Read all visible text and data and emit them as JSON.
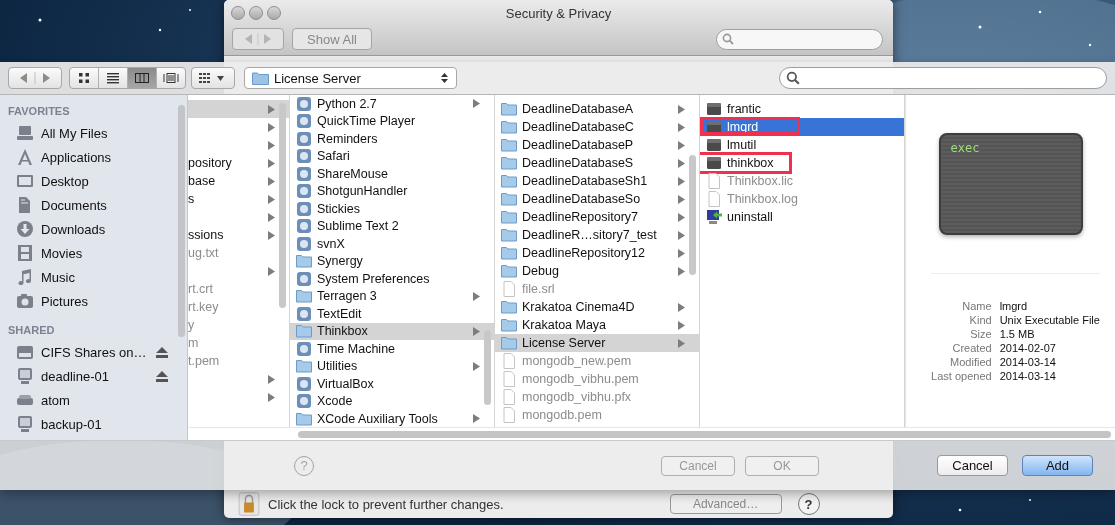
{
  "settings_window": {
    "title": "Security & Privacy",
    "show_all_button": "Show All",
    "help_label": "?",
    "cancel_button": {
      "label": "Cancel",
      "disabled": true
    },
    "ok_button": {
      "label": "OK",
      "disabled": true
    },
    "lock_message": "Click the lock to prevent further changes.",
    "advanced_button": "Advanced…",
    "help_button": "?"
  },
  "toolbar": {
    "views": [
      {
        "kind": "icons",
        "selected": false
      },
      {
        "kind": "list",
        "selected": false
      },
      {
        "kind": "columns",
        "selected": true
      },
      {
        "kind": "coverflow",
        "selected": false
      }
    ],
    "path": "License Server"
  },
  "sidebar": {
    "sections": [
      {
        "title": "FAVORITES",
        "items": [
          {
            "label": "All My Files",
            "kind": "files",
            "eject": false
          },
          {
            "label": "Applications",
            "kind": "apps",
            "eject": false
          },
          {
            "label": "Desktop",
            "kind": "desktop",
            "eject": false
          },
          {
            "label": "Documents",
            "kind": "documents",
            "eject": false
          },
          {
            "label": "Downloads",
            "kind": "downloads",
            "eject": false
          },
          {
            "label": "Movies",
            "kind": "movies",
            "eject": false
          },
          {
            "label": "Music",
            "kind": "music",
            "eject": false
          },
          {
            "label": "Pictures",
            "kind": "pictures",
            "eject": false
          }
        ]
      },
      {
        "title": "SHARED",
        "items": [
          {
            "label": "CIFS Shares on…",
            "kind": "server",
            "eject": true
          },
          {
            "label": "deadline-01",
            "kind": "computer",
            "eject": true
          },
          {
            "label": "atom",
            "kind": "drive",
            "eject": false
          },
          {
            "label": "backup-01",
            "kind": "computer",
            "eject": false
          }
        ]
      }
    ]
  },
  "columns": [
    {
      "focused": false,
      "rows": [
        {
          "selected": true,
          "arrow": true,
          "dim": false
        },
        {
          "selected": false,
          "arrow": true,
          "dim": false
        },
        {
          "selected": false,
          "arrow": true,
          "dim": false
        },
        {
          "label": "pository",
          "selected": false,
          "arrow": true,
          "dim": false
        },
        {
          "label": "base",
          "selected": false,
          "arrow": true,
          "dim": false
        },
        {
          "label": "s",
          "selected": false,
          "arrow": true,
          "dim": false
        },
        {
          "selected": false,
          "arrow": true,
          "dim": false
        },
        {
          "label": "ssions",
          "selected": false,
          "arrow": true,
          "dim": false
        },
        {
          "label": "ug.txt",
          "selected": false,
          "arrow": false,
          "dim": true
        },
        {
          "selected": false,
          "arrow": true,
          "dim": false
        },
        {
          "label": "rt.crt",
          "selected": false,
          "arrow": false,
          "dim": true
        },
        {
          "label": "rt.key",
          "selected": false,
          "arrow": false,
          "dim": true
        },
        {
          "label": "y",
          "selected": false,
          "arrow": false,
          "dim": true
        },
        {
          "label": "m",
          "selected": false,
          "arrow": false,
          "dim": true
        },
        {
          "label": "t.pem",
          "selected": false,
          "arrow": false,
          "dim": true
        },
        {
          "selected": false,
          "arrow": true,
          "dim": false
        },
        {
          "selected": false,
          "arrow": true,
          "dim": false
        }
      ]
    },
    {
      "focused": false,
      "rows": [
        {
          "label": "Python 2.7",
          "kind": "app",
          "selected": false,
          "arrow": true,
          "dim": false
        },
        {
          "label": "QuickTime Player",
          "kind": "app",
          "selected": false,
          "arrow": false,
          "dim": false
        },
        {
          "label": "Reminders",
          "kind": "app",
          "selected": false,
          "arrow": false,
          "dim": false
        },
        {
          "label": "Safari",
          "kind": "app",
          "selected": false,
          "arrow": false,
          "dim": false
        },
        {
          "label": "ShareMouse",
          "kind": "app",
          "selected": false,
          "arrow": false,
          "dim": false
        },
        {
          "label": "ShotgunHandler",
          "kind": "app",
          "selected": false,
          "arrow": false,
          "dim": false
        },
        {
          "label": "Stickies",
          "kind": "app",
          "selected": false,
          "arrow": false,
          "dim": false
        },
        {
          "label": "Sublime Text 2",
          "kind": "app",
          "selected": false,
          "arrow": false,
          "dim": false
        },
        {
          "label": "svnX",
          "kind": "app",
          "selected": false,
          "arrow": false,
          "dim": false
        },
        {
          "label": "Synergy",
          "kind": "folder",
          "selected": false,
          "arrow": false,
          "dim": false
        },
        {
          "label": "System Preferences",
          "kind": "app",
          "selected": false,
          "arrow": false,
          "dim": false
        },
        {
          "label": "Terragen 3",
          "kind": "folder",
          "selected": false,
          "arrow": true,
          "dim": false
        },
        {
          "label": "TextEdit",
          "kind": "app",
          "selected": false,
          "arrow": false,
          "dim": false
        },
        {
          "label": "Thinkbox",
          "kind": "folder",
          "selected": true,
          "arrow": true,
          "dim": false
        },
        {
          "label": "Time Machine",
          "kind": "app",
          "selected": false,
          "arrow": false,
          "dim": false
        },
        {
          "label": "Utilities",
          "kind": "folder",
          "selected": false,
          "arrow": true,
          "dim": false
        },
        {
          "label": "VirtualBox",
          "kind": "app",
          "selected": false,
          "arrow": false,
          "dim": false
        },
        {
          "label": "Xcode",
          "kind": "app",
          "selected": false,
          "arrow": false,
          "dim": false
        },
        {
          "label": "XCode Auxiliary Tools",
          "kind": "folder",
          "selected": false,
          "arrow": true,
          "dim": false
        }
      ]
    },
    {
      "focused": false,
      "rows": [
        {
          "label": "DeadlineDatabaseA",
          "kind": "folder",
          "selected": false,
          "arrow": true,
          "dim": false
        },
        {
          "label": "DeadlineDatabaseC",
          "kind": "folder",
          "selected": false,
          "arrow": true,
          "dim": false
        },
        {
          "label": "DeadlineDatabaseP",
          "kind": "folder",
          "selected": false,
          "arrow": true,
          "dim": false
        },
        {
          "label": "DeadlineDatabaseS",
          "kind": "folder",
          "selected": false,
          "arrow": true,
          "dim": false
        },
        {
          "label": "DeadlineDatabaseSh1",
          "kind": "folder",
          "selected": false,
          "arrow": true,
          "dim": false
        },
        {
          "label": "DeadlineDatabaseSo",
          "kind": "folder",
          "selected": false,
          "arrow": true,
          "dim": false
        },
        {
          "label": "DeadlineRepository7",
          "kind": "folder",
          "selected": false,
          "arrow": true,
          "dim": false
        },
        {
          "label": "DeadlineR…sitory7_test",
          "kind": "folder",
          "selected": false,
          "arrow": true,
          "dim": false
        },
        {
          "label": "DeadlineRepository12",
          "kind": "folder",
          "selected": false,
          "arrow": true,
          "dim": false
        },
        {
          "label": "Debug",
          "kind": "folder",
          "selected": false,
          "arrow": true,
          "dim": false
        },
        {
          "label": "file.srl",
          "kind": "doc",
          "selected": false,
          "arrow": false,
          "dim": true
        },
        {
          "label": "Krakatoa Cinema4D",
          "kind": "folder",
          "selected": false,
          "arrow": true,
          "dim": false
        },
        {
          "label": "Krakatoa Maya",
          "kind": "folder",
          "selected": false,
          "arrow": true,
          "dim": false
        },
        {
          "label": "License Server",
          "kind": "folder",
          "selected": true,
          "arrow": true,
          "dim": false
        },
        {
          "label": "mongodb_new.pem",
          "kind": "doc",
          "selected": false,
          "arrow": false,
          "dim": true
        },
        {
          "label": "mongodb_vibhu.pem",
          "kind": "doc",
          "selected": false,
          "arrow": false,
          "dim": true
        },
        {
          "label": "mongodb_vibhu.pfx",
          "kind": "doc",
          "selected": false,
          "arrow": false,
          "dim": true
        },
        {
          "label": "mongodb.pem",
          "kind": "doc",
          "selected": false,
          "arrow": false,
          "dim": true
        }
      ]
    },
    {
      "focused": true,
      "rows": [
        {
          "label": "frantic",
          "kind": "exec",
          "selected": false,
          "arrow": false,
          "dim": false,
          "marked": false
        },
        {
          "label": "lmgrd",
          "kind": "exec",
          "selected": true,
          "arrow": false,
          "dim": false,
          "marked": true
        },
        {
          "label": "lmutil",
          "kind": "exec",
          "selected": false,
          "arrow": false,
          "dim": false,
          "marked": false
        },
        {
          "label": "thinkbox",
          "kind": "exec",
          "selected": false,
          "arrow": false,
          "dim": false,
          "marked": true
        },
        {
          "label": "Thinkbox.lic",
          "kind": "doc",
          "selected": false,
          "arrow": false,
          "dim": true,
          "marked": false
        },
        {
          "label": "Thinkbox.log",
          "kind": "doc",
          "selected": false,
          "arrow": false,
          "dim": true,
          "marked": false
        },
        {
          "label": "uninstall",
          "kind": "installer",
          "selected": false,
          "arrow": false,
          "dim": false,
          "marked": false
        }
      ]
    }
  ],
  "preview": {
    "icon_text": "exec",
    "info": [
      {
        "key": "Name",
        "value": "lmgrd"
      },
      {
        "key": "Kind",
        "value": "Unix Executable File"
      },
      {
        "key": "Size",
        "value": "1.5 MB"
      },
      {
        "key": "Created",
        "value": "2014-02-07"
      },
      {
        "key": "Modified",
        "value": "2014-03-14"
      },
      {
        "key": "Last opened",
        "value": "2014-03-14"
      }
    ]
  },
  "footer": {
    "buttons": [
      {
        "label": "Cancel",
        "default": false
      },
      {
        "label": "Add",
        "default": true
      }
    ]
  }
}
